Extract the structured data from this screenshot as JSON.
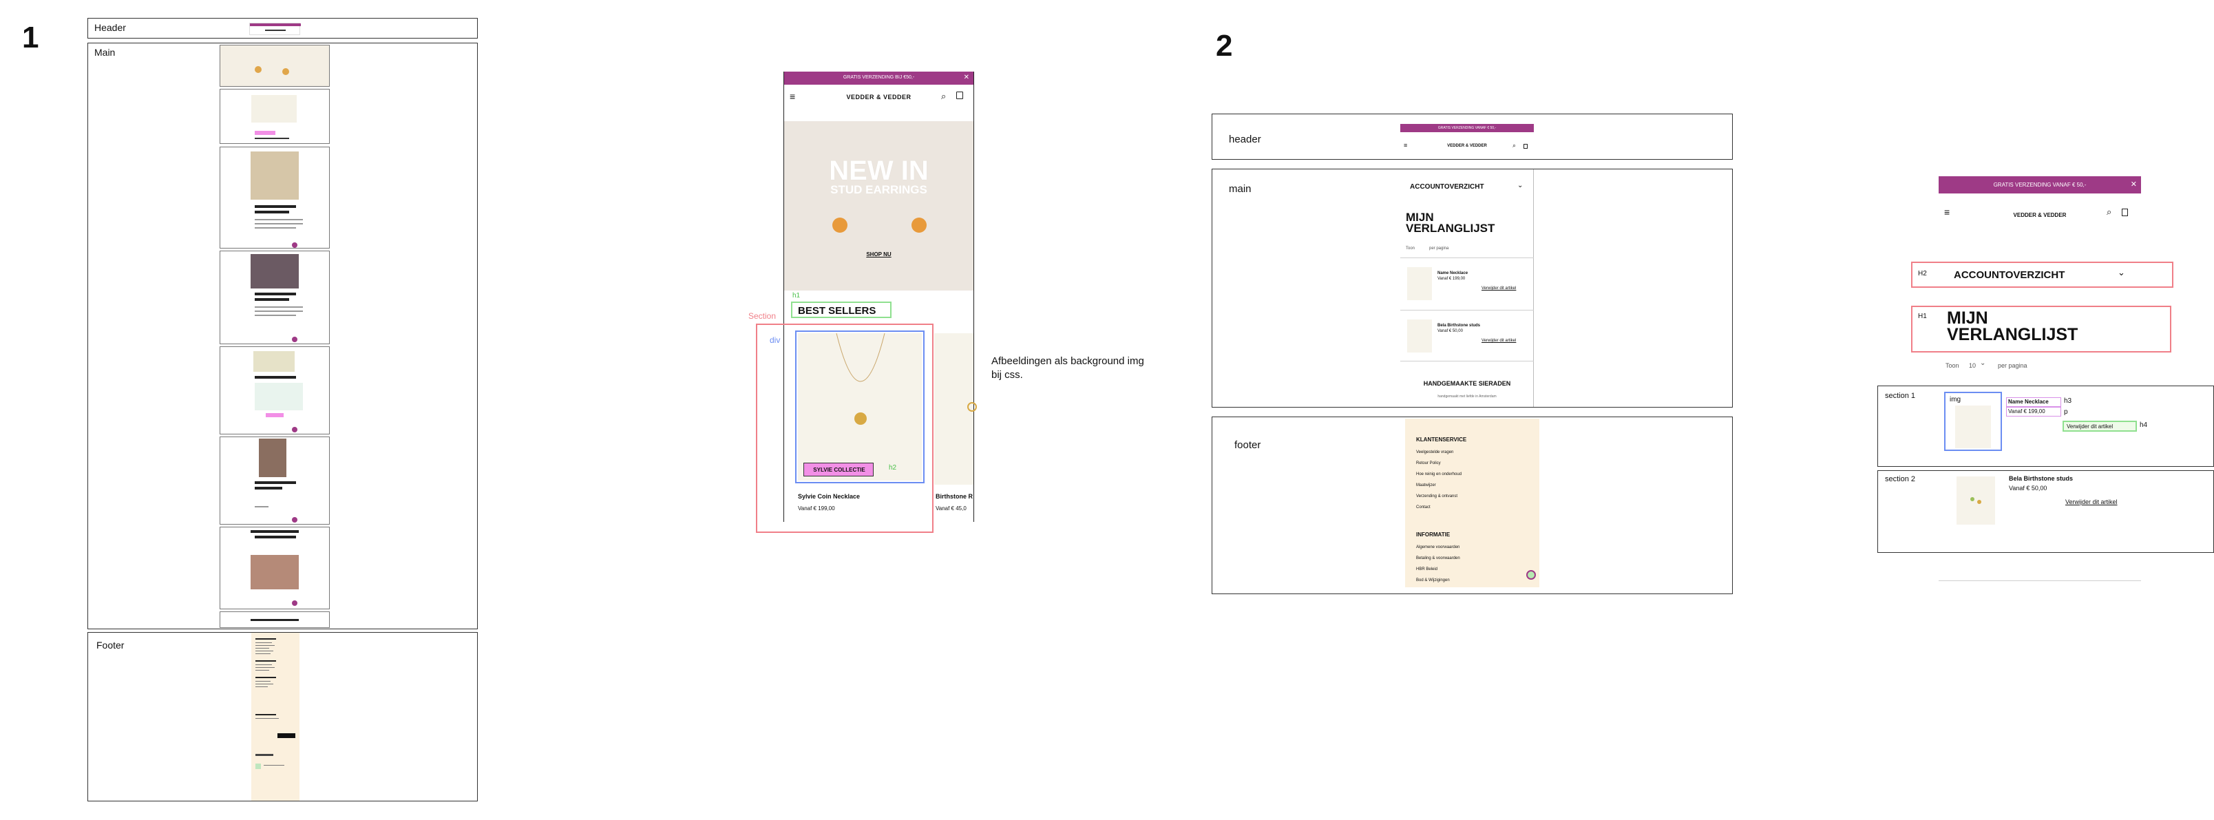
{
  "sections": {
    "one": {
      "number": "1",
      "header": "Header",
      "main": "Main",
      "footer": "Footer"
    },
    "two": {
      "number": "2",
      "header": "header",
      "main": "main",
      "footer": "footer"
    }
  },
  "mobile1": {
    "promo": "GRATIS VERZENDING BIJ €50,-",
    "brand": "VEDDER & VEDDER",
    "hero_title": "NEW IN",
    "hero_sub": "STUD EARRINGS",
    "shop_now": "SHOP NU",
    "h1": "h1",
    "section_heading": "BEST SELLERS",
    "button": "SYLVIE COLLECTIE",
    "h2": "h2",
    "product1_name": "Sylvie Coin Necklace",
    "product1_price": "Vanaf € 199,00",
    "product2_name": "Birthstone R",
    "product2_price": "Vanaf € 45,0"
  },
  "annotations": {
    "section": "Section",
    "div": "div",
    "note_line1": "Afbeeldingen als background img",
    "note_line2": "bij css."
  },
  "mobile2": {
    "promo": "GRATIS VERZENDING VANAF € 50,-",
    "brand": "VEDDER & VEDDER",
    "account": "ACCOUNTOVERZICHT",
    "title_line1": "MIJN",
    "title_line2": "VERLANGLIJST",
    "toon": "Toon",
    "per_page": "per pagina",
    "item1_name": "Name Necklace",
    "item1_price": "Vanaf € 199,00",
    "remove": "Verwijder dit artikel",
    "item2_name": "Bela Birthstone studs",
    "item2_price": "Vanaf € 50,00",
    "handmade": "HANDGEMAAKTE SIERADEN",
    "handmade_sub": "handgemaakt met liefde in Amsterdam",
    "service_heading": "KLANTENSERVICE",
    "service_items": [
      "Veelgestelde vragen",
      "Retour Policy",
      "Hoe reinig en onderhoud",
      "Maatwijzer",
      "Verzending & ontvanst",
      "Contact"
    ],
    "info_heading": "INFORMATIE",
    "info_items": [
      "Algemene voorwaarden",
      "Betaling & voorwaarden",
      "HBR Beleid",
      "Bod & Wijzigingen"
    ]
  },
  "detail": {
    "promo": "GRATIS VERZENDING VANAF € 50,-",
    "brand": "VEDDER & VEDDER",
    "h2_tag": "H2",
    "account": "ACCOUNTOVERZICHT",
    "h1_tag": "H1",
    "title_line1": "MIJN",
    "title_line2": "VERLANGLIJST",
    "toon": "Toon",
    "toon_value": "10",
    "per_page": "per pagina",
    "section1": "section 1",
    "img_tag": "img",
    "h3_tag": "h3",
    "p_tag": "p",
    "h4_tag": "h4",
    "item1_name": "Name Necklace",
    "item1_price": "Vanaf € 199,00",
    "remove": "Verwijder dit artikel",
    "section2": "section 2",
    "item2_name": "Bela Birthstone studs",
    "item2_price": "Vanaf € 50,00"
  },
  "colors": {
    "purple": "#9e3a86",
    "cream": "#fbf0dd",
    "red_annotation": "#f07f88",
    "green_annotation": "#8fe08f",
    "blue_annotation": "#6b8df2",
    "pink_button": "#f28fe6"
  }
}
